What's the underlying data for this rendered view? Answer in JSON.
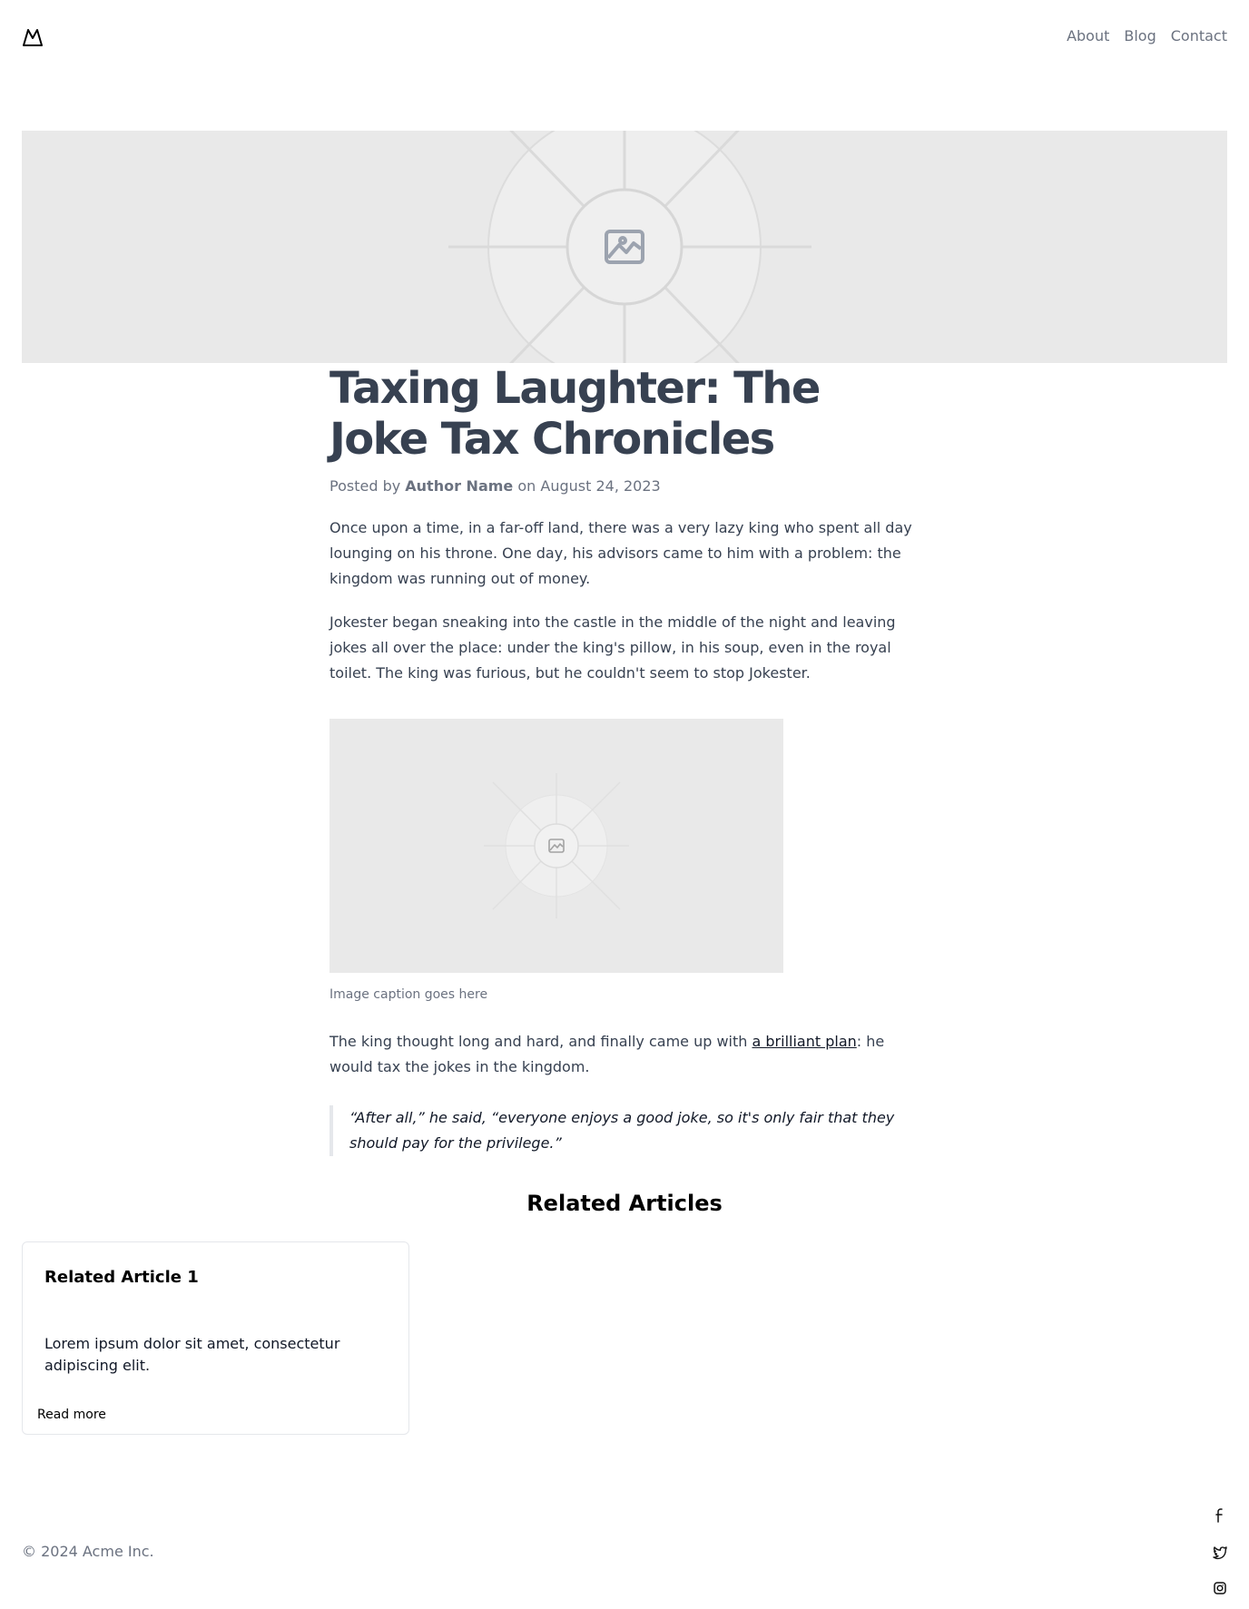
{
  "header": {
    "logo_icon": "mountain-icon",
    "nav": [
      {
        "label": "About"
      },
      {
        "label": "Blog"
      },
      {
        "label": "Contact"
      }
    ]
  },
  "hero": {
    "icon": "image-placeholder-icon"
  },
  "article": {
    "title": "Taxing Laughter: The Joke Tax Chronicles",
    "meta": {
      "prefix": "Posted by",
      "author": "Author Name",
      "middle": "on",
      "date": "August 24, 2023"
    },
    "paragraph_1": "Once upon a time, in a far-off land, there was a very lazy king who spent all day lounging on his throne. One day, his advisors came to him with a problem: the kingdom was running out of money.",
    "paragraph_2": "Jokester began sneaking into the castle in the middle of the night and leaving jokes all over the place: under the king's pillow, in his soup, even in the royal toilet. The king was furious, but he couldn't seem to stop Jokester.",
    "figure": {
      "caption": "Image caption goes here"
    },
    "paragraph_3": {
      "before": "The king thought long and hard, and finally came up with ",
      "link": "a brilliant plan",
      "after": ": he would tax the jokes in the kingdom."
    },
    "quote": "“After all,” he said, “everyone enjoys a good joke, so it's only fair that they should pay for the privilege.”"
  },
  "related": {
    "heading": "Related Articles",
    "cards": [
      {
        "title": "Related Article 1",
        "text": "Lorem ipsum dolor sit amet, consectetur adipiscing elit.",
        "link": "Read more"
      }
    ]
  },
  "footer": {
    "copyright": "© 2024 Acme Inc.",
    "social": [
      "facebook-icon",
      "twitter-icon",
      "instagram-icon"
    ]
  },
  "colors": {
    "text": "#374151",
    "muted": "#6b7280",
    "placeholder_bg": "#e9e9e9",
    "border": "#e5e7eb"
  }
}
